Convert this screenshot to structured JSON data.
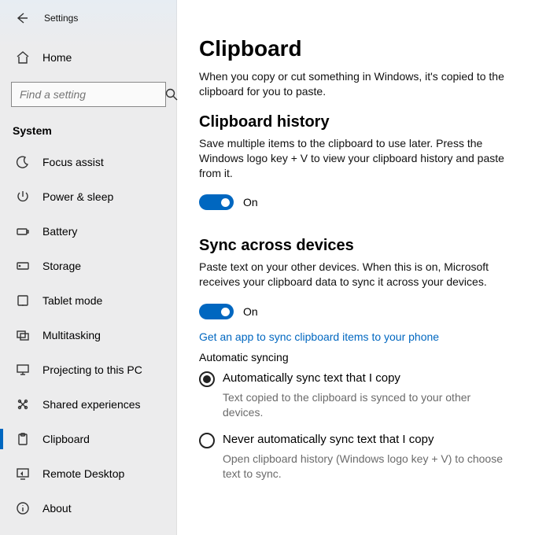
{
  "app": {
    "title": "Settings"
  },
  "home": {
    "label": "Home"
  },
  "search": {
    "placeholder": "Find a setting"
  },
  "group": {
    "label": "System"
  },
  "nav": {
    "items": [
      {
        "label": "Focus assist"
      },
      {
        "label": "Power & sleep"
      },
      {
        "label": "Battery"
      },
      {
        "label": "Storage"
      },
      {
        "label": "Tablet mode"
      },
      {
        "label": "Multitasking"
      },
      {
        "label": "Projecting to this PC"
      },
      {
        "label": "Shared experiences"
      },
      {
        "label": "Clipboard"
      },
      {
        "label": "Remote Desktop"
      },
      {
        "label": "About"
      }
    ]
  },
  "page": {
    "title": "Clipboard",
    "intro": "When you copy or cut something in Windows, it's copied to the clipboard for you to paste."
  },
  "history": {
    "heading": "Clipboard history",
    "desc": "Save multiple items to the clipboard to use later. Press the Windows logo key + V to view your clipboard history and paste from it.",
    "toggle_state": "On"
  },
  "sync": {
    "heading": "Sync across devices",
    "desc": "Paste text on your other devices. When this is on, Microsoft receives your clipboard data to sync it across your devices.",
    "toggle_state": "On",
    "link": "Get an app to sync clipboard items to your phone",
    "auto_heading": "Automatic syncing",
    "opt1": {
      "label": "Automatically sync text that I copy",
      "desc": "Text copied to the clipboard is synced to your other devices."
    },
    "opt2": {
      "label": "Never automatically sync text that I copy",
      "desc": "Open clipboard history (Windows logo key + V) to choose text to sync."
    }
  }
}
